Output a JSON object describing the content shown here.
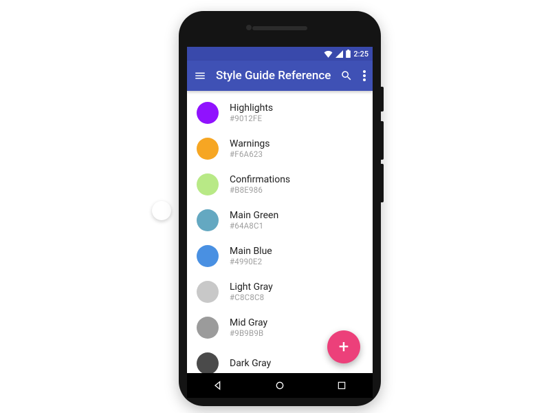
{
  "statusbar": {
    "time": "2:25"
  },
  "appbar": {
    "title": "Style Guide Reference"
  },
  "fab": {
    "glyph": "+"
  },
  "colors": [
    {
      "name": "Highlights",
      "hex": "#9012FE",
      "swatch": "#9012FE"
    },
    {
      "name": "Warnings",
      "hex": "#F6A623",
      "swatch": "#F6A623"
    },
    {
      "name": "Confirmations",
      "hex": "#B8E986",
      "swatch": "#B8E986"
    },
    {
      "name": "Main Green",
      "hex": "#64A8C1",
      "swatch": "#64A8C1"
    },
    {
      "name": "Main Blue",
      "hex": "#4990E2",
      "swatch": "#4990E2"
    },
    {
      "name": "Light Gray",
      "hex": "#C8C8C8",
      "swatch": "#C8C8C8"
    },
    {
      "name": "Mid Gray",
      "hex": "#9B9B9B",
      "swatch": "#9B9B9B"
    },
    {
      "name": "Dark Gray",
      "hex": "",
      "swatch": "#4A4A4A"
    }
  ]
}
